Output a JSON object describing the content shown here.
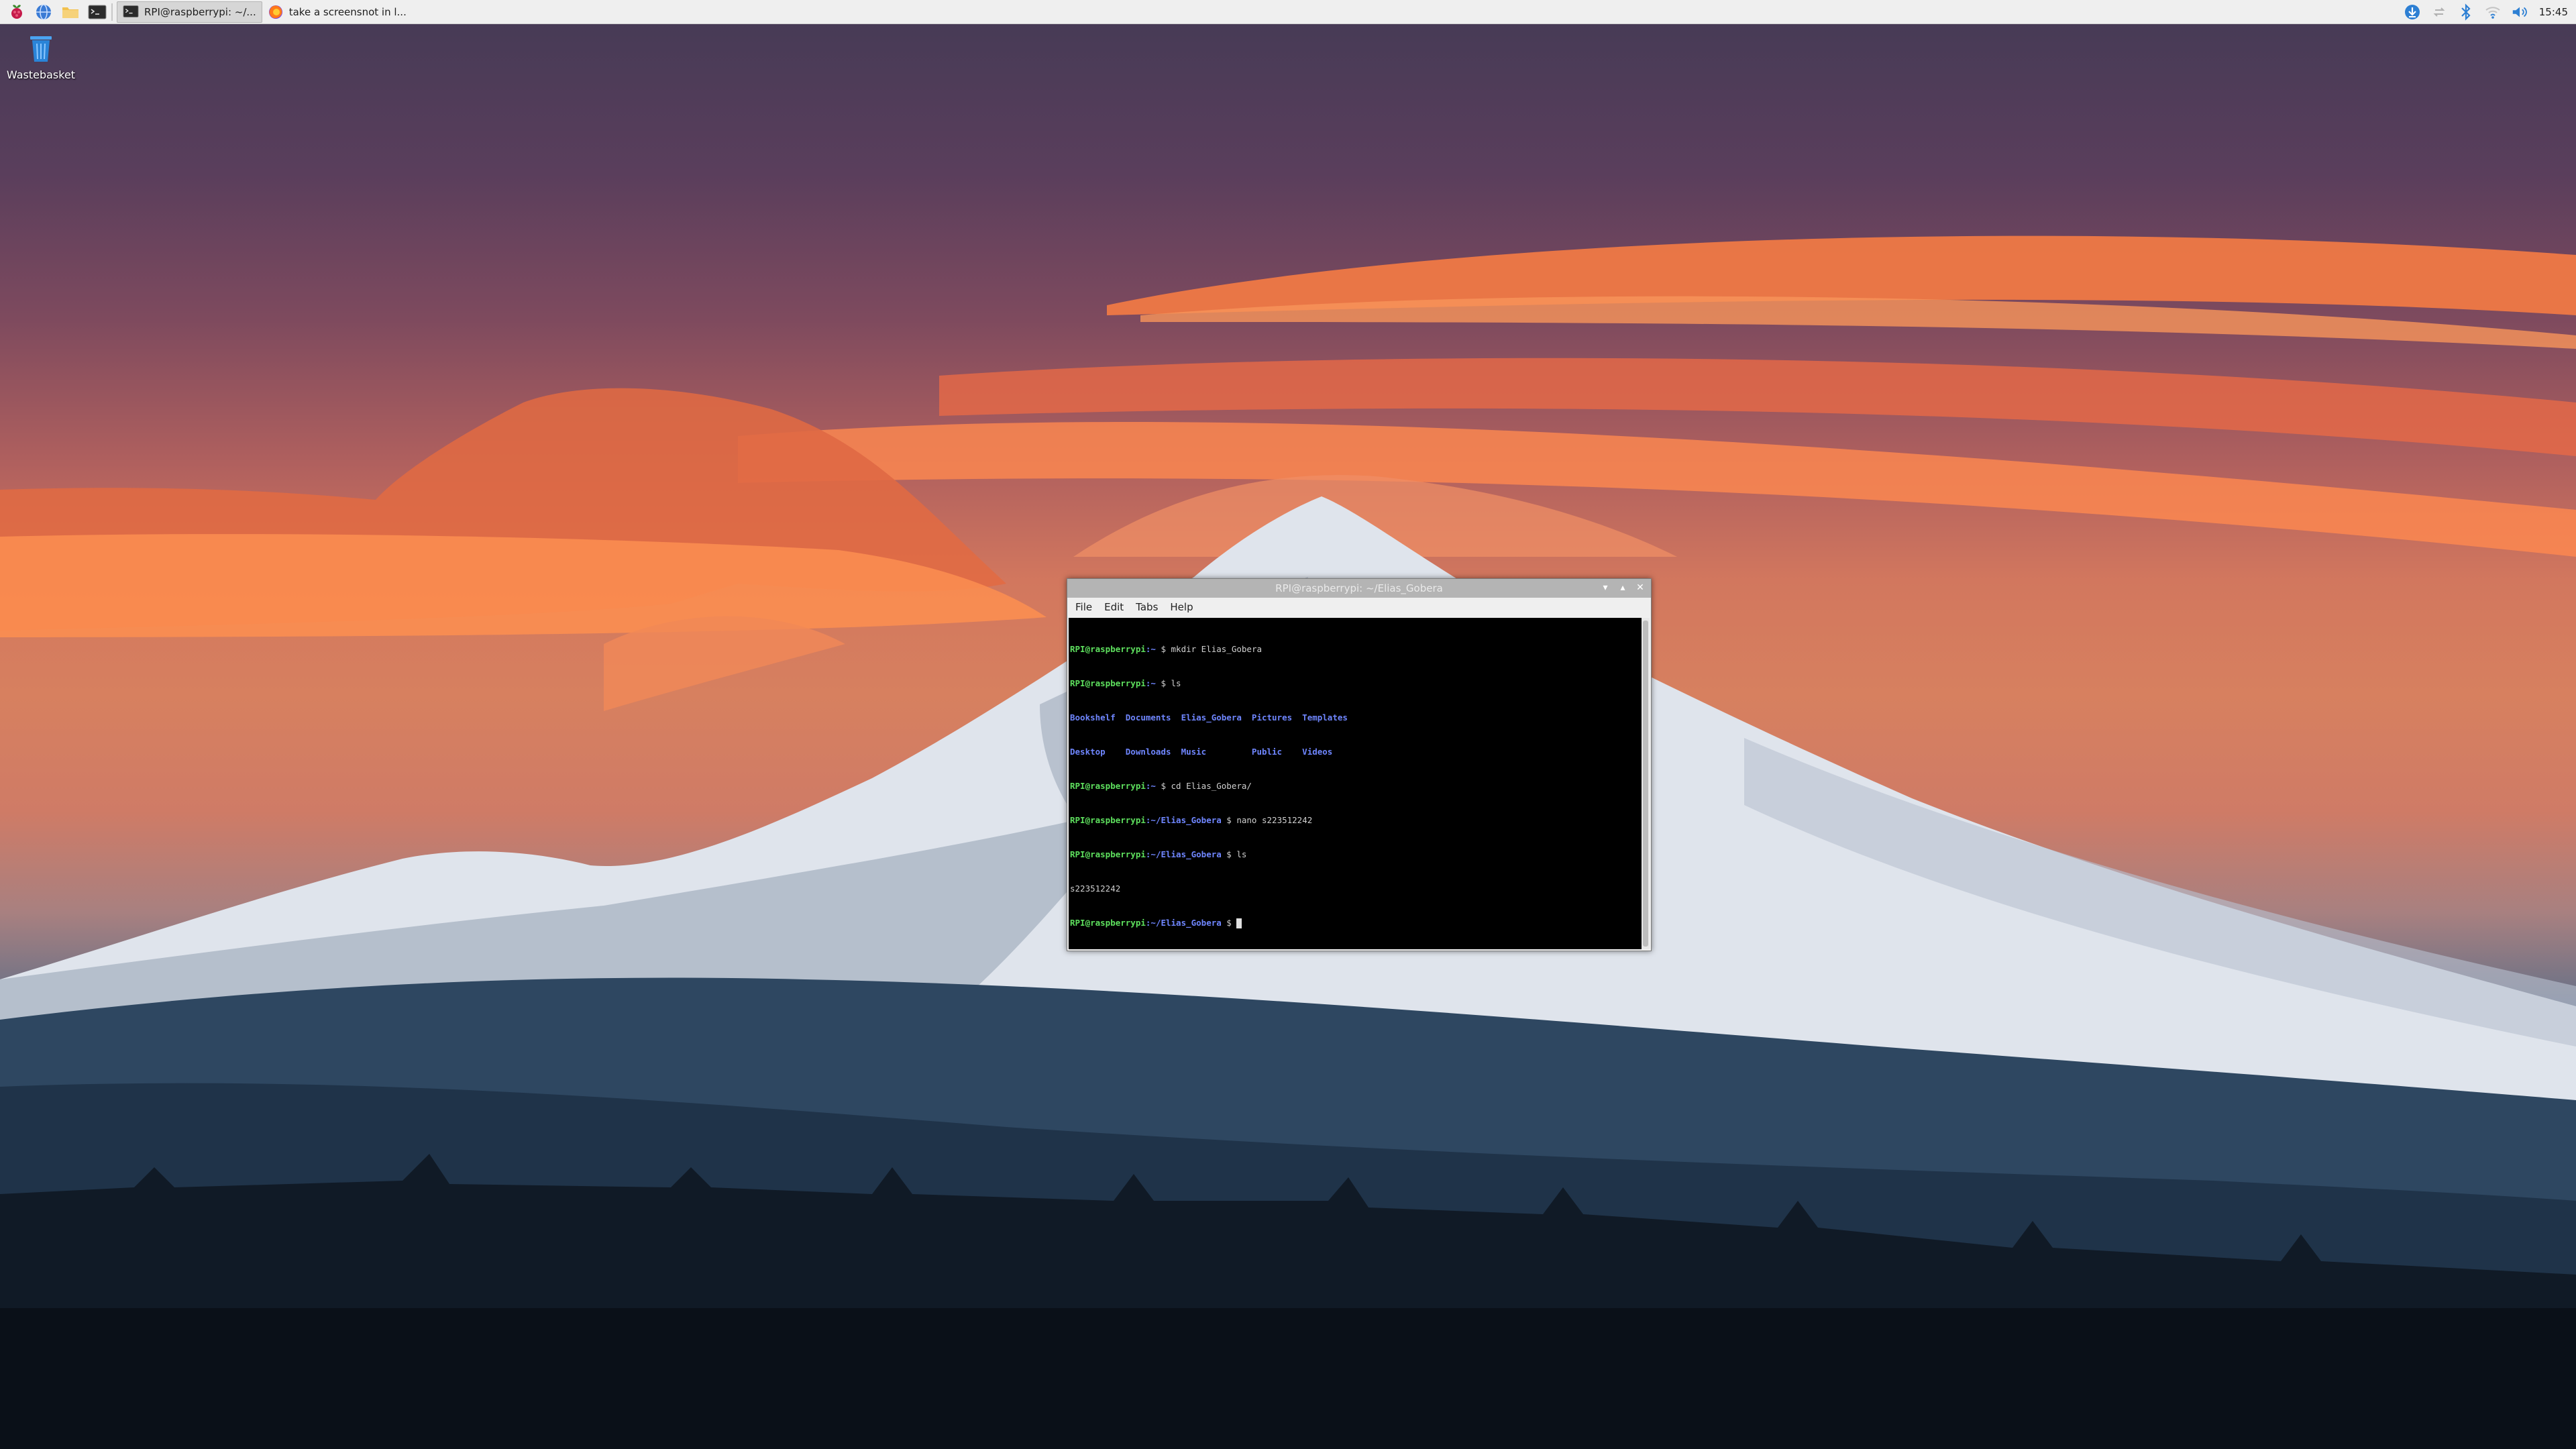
{
  "taskbar": {
    "tasks": [
      {
        "label": "RPI@raspberrypi: ~/...",
        "icon": "terminal-icon"
      },
      {
        "label": "take a screensnot in l...",
        "icon": "firefox-icon"
      }
    ],
    "launchers": [
      "raspberry-menu-icon",
      "browser-icon",
      "file-manager-icon",
      "terminal-icon"
    ],
    "tray_icons": [
      "download-icon",
      "network-transfer-icon",
      "bluetooth-icon",
      "wifi-icon",
      "volume-icon"
    ],
    "clock": "15:45"
  },
  "desktop": {
    "icons": [
      {
        "label": "Wastebasket",
        "icon": "trash-icon"
      }
    ]
  },
  "terminal": {
    "title": "RPI@raspberrypi: ~/Elias_Gobera",
    "menu": [
      "File",
      "Edit",
      "Tabs",
      "Help"
    ],
    "lines": [
      {
        "user": "RPI@raspberrypi",
        "path": ":~",
        "cmd": " $ mkdir Elias_Gobera"
      },
      {
        "user": "RPI@raspberrypi",
        "path": ":~",
        "cmd": " $ ls"
      },
      {
        "dirs": "Bookshelf  Documents  Elias_Gobera  Pictures  Templates"
      },
      {
        "dirs": "Desktop    Downloads  Music         Public    Videos"
      },
      {
        "user": "RPI@raspberrypi",
        "path": ":~",
        "cmd": " $ cd Elias_Gobera/"
      },
      {
        "user": "RPI@raspberrypi",
        "path": ":~/Elias_Gobera",
        "cmd": " $ nano s223512242"
      },
      {
        "user": "RPI@raspberrypi",
        "path": ":~/Elias_Gobera",
        "cmd": " $ ls"
      },
      {
        "plain": "s223512242"
      },
      {
        "user": "RPI@raspberrypi",
        "path": ":~/Elias_Gobera",
        "cmd": " $ ",
        "cursor": true
      }
    ]
  },
  "colors": {
    "prompt_user": "#5ee05e",
    "prompt_path": "#6f86ff",
    "terminal_bg": "#000000"
  }
}
